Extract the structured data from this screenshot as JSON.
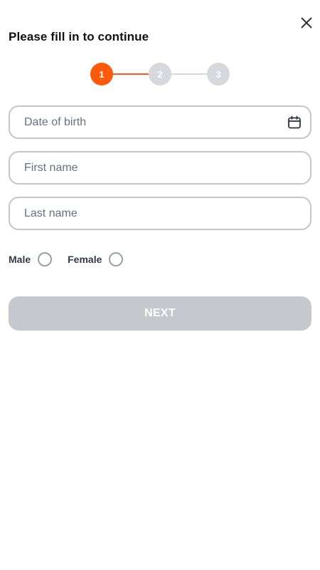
{
  "header": {
    "title": "Please fill in to continue",
    "close_icon": "close-icon"
  },
  "stepper": {
    "current_step": 1,
    "steps": [
      "1",
      "2",
      "3"
    ],
    "active_color": "#ff5a0a",
    "inactive_color": "#d6d8dd"
  },
  "form": {
    "dob_placeholder": "Date of birth",
    "dob_icon": "calendar-icon",
    "first_name_placeholder": "First name",
    "last_name_placeholder": "Last name",
    "gender": {
      "male_label": "Male",
      "female_label": "Female"
    },
    "next_label": "NEXT"
  }
}
